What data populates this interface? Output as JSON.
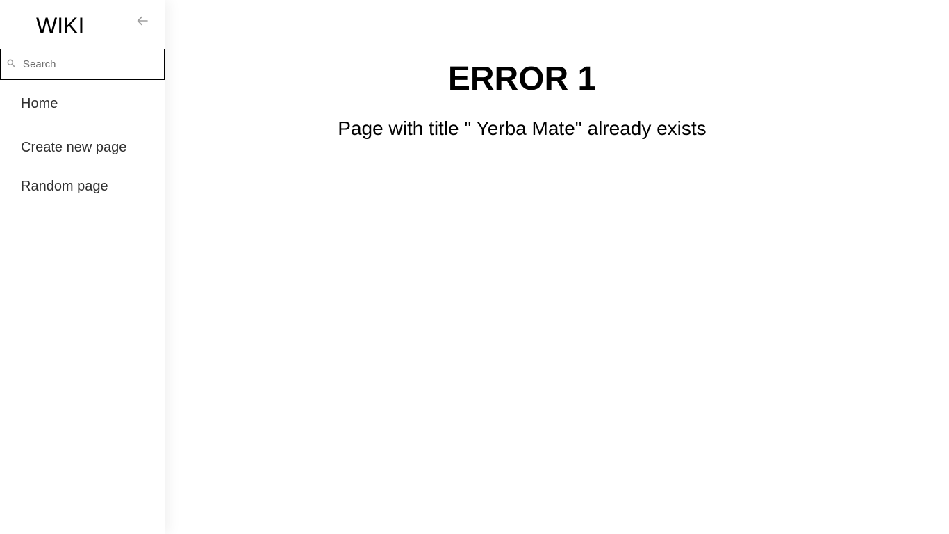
{
  "sidebar": {
    "brand": "WIKI",
    "collapse_icon": "arrow-left-icon",
    "search": {
      "placeholder": "Search",
      "value": "",
      "icon": "search-icon"
    },
    "nav": {
      "home": "Home",
      "create": "Create new page",
      "random": "Random page"
    }
  },
  "main": {
    "error_title": "ERROR 1",
    "error_message": "Page with title \" Yerba Mate\" already exists"
  },
  "colors": {
    "text": "#000000",
    "nav_text": "#2f2f2f",
    "icon": "#9e9e9e",
    "search_border": "#000000",
    "background": "#ffffff"
  }
}
